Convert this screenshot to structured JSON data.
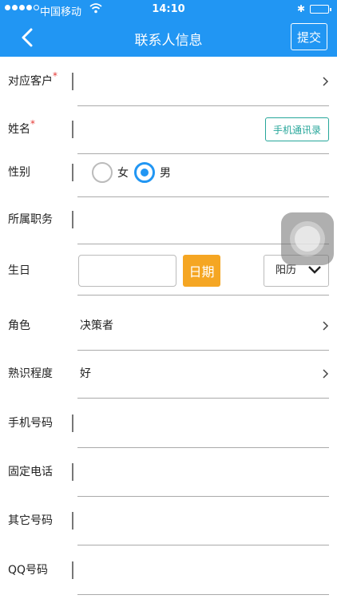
{
  "status_bar": {
    "carrier": "中国移动",
    "time": "14:10",
    "signal_bars_filled": 4,
    "signal_bars_total": 5
  },
  "nav": {
    "title": "联系人信息",
    "submit_label": "提交",
    "back_icon": "chevron-left-icon"
  },
  "fields": {
    "customer": {
      "label": "对应客户",
      "required_mark": "*",
      "value": ""
    },
    "name": {
      "label": "姓名",
      "required_mark": "*",
      "value": "",
      "contacts_button": "手机通讯录"
    },
    "gender": {
      "label": "性别",
      "options": [
        "女",
        "男"
      ],
      "selected": "男"
    },
    "position": {
      "label": "所属职务",
      "value": ""
    },
    "birthday": {
      "label": "生日",
      "value": "",
      "date_button": "日期",
      "calendar_type": "阳历"
    },
    "role": {
      "label": "角色",
      "value": "决策者"
    },
    "familiarity": {
      "label": "熟识程度",
      "value": "好"
    },
    "mobile": {
      "label": "手机号码",
      "value": ""
    },
    "landline": {
      "label": "固定电话",
      "value": ""
    },
    "other_number": {
      "label": "其它号码",
      "value": ""
    },
    "qq": {
      "label": "QQ号码",
      "value": ""
    }
  },
  "colors": {
    "primary": "#2196f3",
    "accent_orange": "#f5a623",
    "required_red": "#e53935",
    "contacts_teal": "#26a69a"
  }
}
